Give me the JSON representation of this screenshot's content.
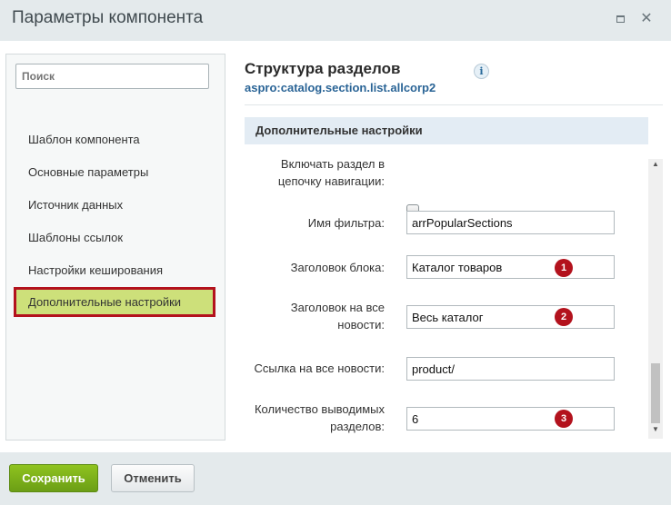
{
  "window": {
    "title": "Параметры компонента",
    "maximize_icon": "maximize-icon",
    "close_icon": "close-icon",
    "close_glyph": "✕"
  },
  "sidebar": {
    "search_placeholder": "Поиск",
    "items": [
      {
        "label": "Шаблон компонента"
      },
      {
        "label": "Основные параметры"
      },
      {
        "label": "Источник данных"
      },
      {
        "label": "Шаблоны ссылок"
      },
      {
        "label": "Настройки кеширования"
      },
      {
        "label": "Дополнительные настройки",
        "active": true
      }
    ]
  },
  "header": {
    "title": "Структура разделов",
    "subtitle": "aspro:catalog.section.list.allcorp2",
    "info_glyph": "i"
  },
  "section": {
    "title": "Дополнительные настройки"
  },
  "fields": {
    "nav_chain_label": "Включать раздел в цепочку навигации:",
    "nav_chain_checked": false,
    "filter_name_label": "Имя фильтра:",
    "filter_name_value": "arrPopularSections",
    "block_title_label": "Заголовок блока:",
    "block_title_value": "Каталог товаров",
    "all_news_title_label": "Заголовок на все новости:",
    "all_news_title_value": "Весь каталог",
    "all_news_link_label": "Ссылка на все новости:",
    "all_news_link_value": "product/",
    "count_label": "Количество выводимых разделов:",
    "count_value": "6"
  },
  "badges": [
    "1",
    "2",
    "3"
  ],
  "scroll": {
    "up_glyph": "▲",
    "down_glyph": "▼"
  },
  "footer": {
    "save_label": "Сохранить",
    "cancel_label": "Отменить"
  },
  "colors": {
    "active_item_bg": "#cde07a",
    "highlight_border": "#b3121d",
    "badge": "#b3121d",
    "save_button": "#7cb31a",
    "link_subtitle": "#2a6496"
  }
}
